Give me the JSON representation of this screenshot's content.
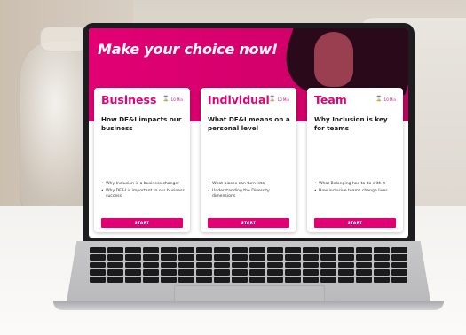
{
  "page": {
    "title": "Make your choice now!",
    "brand_color": "#e20074"
  },
  "cards": [
    {
      "title": "Business",
      "time": "10 Min",
      "subtitle": "How DE&I impacts our business",
      "bullets": [
        "Why Inclusion is a business changer",
        "Why DE&I is important to our business success"
      ],
      "button": "START"
    },
    {
      "title": "Individual",
      "time": "10 Min",
      "subtitle": "What DE&I means on a personal level",
      "bullets": [
        "What biases can turn into",
        "Understanding the Diversity dimensions"
      ],
      "button": "START"
    },
    {
      "title": "Team",
      "time": "10 Min",
      "subtitle": "Why Inclusion is key for teams",
      "bullets": [
        "What Belonging has to do with it",
        "How inclusive teams change lives"
      ],
      "button": "START"
    }
  ],
  "icons": {
    "time": "hourglass-icon"
  }
}
